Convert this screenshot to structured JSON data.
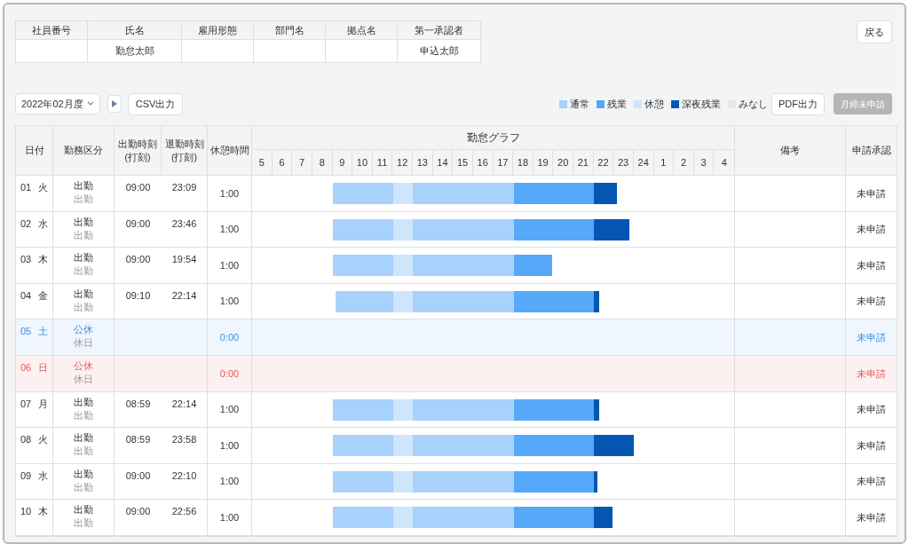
{
  "employee": [
    {
      "label": "社員番号"
    },
    {
      "label": "氏名",
      "value": "勤怠太郎"
    },
    {
      "label": "雇用形態"
    },
    {
      "label": "部門名"
    },
    {
      "label": "拠点名"
    },
    {
      "label": "第一承認者",
      "value": "申込太郎"
    }
  ],
  "back_button": "戻る",
  "month_select": {
    "value": "2022年02月度"
  },
  "csv_button": "CSV出力",
  "legend": [
    {
      "label": "通常",
      "color": "#a8d1fb"
    },
    {
      "label": "残業",
      "color": "#56a8f8"
    },
    {
      "label": "休憩",
      "color": "#cfe5fc"
    },
    {
      "label": "深夜残業",
      "color": "#0556b3"
    },
    {
      "label": "みなし",
      "color": "#e5e7eb"
    }
  ],
  "pdf_button": "PDF出力",
  "submit_button": {
    "label": "月締未申請",
    "disabled": true
  },
  "table": {
    "columns": [
      "日付",
      "勤務区分",
      "出勤時刻\n(打刻)",
      "退勤時刻\n(打刻)",
      "休憩時間",
      "勤怠グラフ",
      "備考",
      "申請承認"
    ],
    "hours": [
      "5",
      "6",
      "7",
      "8",
      "9",
      "10",
      "11",
      "12",
      "13",
      "14",
      "15",
      "16",
      "17",
      "18",
      "19",
      "20",
      "21",
      "22",
      "23",
      "24",
      "1",
      "2",
      "3",
      "4"
    ],
    "rows": [
      {
        "kind": "weekday",
        "date": "01",
        "weekday": "火",
        "work_type": "出勤",
        "work_sub": "出勤",
        "start": "09:00",
        "end": "23:09",
        "break": "1:00",
        "status": "未申請"
      },
      {
        "kind": "weekday",
        "date": "02",
        "weekday": "水",
        "work_type": "出勤",
        "work_sub": "出勤",
        "start": "09:00",
        "end": "23:46",
        "break": "1:00",
        "status": "未申請"
      },
      {
        "kind": "weekday",
        "date": "03",
        "weekday": "木",
        "work_type": "出勤",
        "work_sub": "出勤",
        "start": "09:00",
        "end": "19:54",
        "break": "1:00",
        "status": "未申請"
      },
      {
        "kind": "weekday",
        "date": "04",
        "weekday": "金",
        "work_type": "出勤",
        "work_sub": "出勤",
        "start": "09:10",
        "end": "22:14",
        "break": "1:00",
        "status": "未申請"
      },
      {
        "kind": "saturday",
        "date": "05",
        "weekday": "土",
        "work_type": "公休",
        "work_sub": "休日",
        "break": "0:00",
        "status": "未申請"
      },
      {
        "kind": "sunday",
        "date": "06",
        "weekday": "日",
        "work_type": "公休",
        "work_sub": "休日",
        "break": "0:00",
        "status": "未申請"
      },
      {
        "kind": "weekday",
        "date": "07",
        "weekday": "月",
        "work_type": "出勤",
        "work_sub": "出勤",
        "start": "08:59",
        "end": "22:14",
        "break": "1:00",
        "status": "未申請"
      },
      {
        "kind": "weekday",
        "date": "08",
        "weekday": "火",
        "work_type": "出勤",
        "work_sub": "出勤",
        "start": "08:59",
        "end": "23:58",
        "break": "1:00",
        "status": "未申請"
      },
      {
        "kind": "weekday",
        "date": "09",
        "weekday": "水",
        "work_type": "出勤",
        "work_sub": "出勤",
        "start": "09:00",
        "end": "22:10",
        "break": "1:00",
        "status": "未申請"
      },
      {
        "kind": "weekday",
        "date": "10",
        "weekday": "木",
        "work_type": "出勤",
        "work_sub": "出勤",
        "start": "09:00",
        "end": "22:56",
        "break": "1:00",
        "status": "未申請"
      }
    ]
  }
}
